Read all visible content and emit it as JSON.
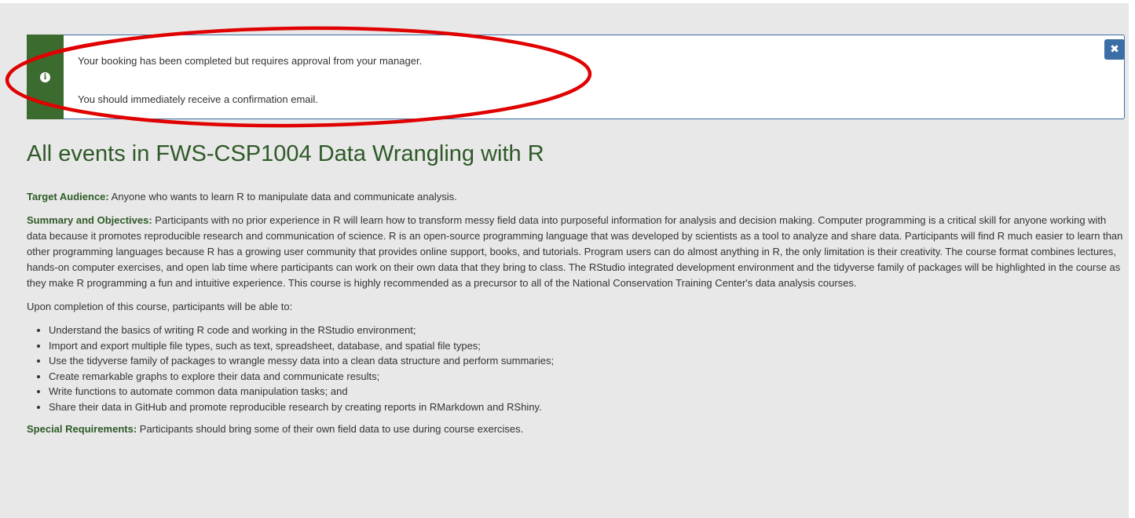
{
  "alert": {
    "icon": "info-icon",
    "line1": "Your booking has been completed but requires approval from your manager.",
    "line2": "You should immediately receive a confirmation email.",
    "close_icon": "close-icon",
    "close_symbol": "✖"
  },
  "page": {
    "title": "All events in FWS-CSP1004 Data Wrangling with R"
  },
  "course": {
    "target_audience_label": "Target Audience:",
    "target_audience_text": "Anyone who wants to learn R to manipulate data and communicate analysis.",
    "summary_label": "Summary and Objectives:",
    "summary_text": "Participants with no prior experience in R will learn how to transform messy field data into purposeful information for analysis and decision making. Computer programming is a critical skill for anyone working with data because it promotes reproducible research and communication of science. R is an open-source programming language that was developed by scientists as a tool to analyze and share data. Participants will find R much easier to learn than other programming languages because R has a growing user community that provides online support, books, and tutorials. Program users can do almost anything in R, the only limitation is their creativity. The course format combines lectures, hands-on computer exercises, and open lab time where participants can work on their own data that they bring to class. The RStudio integrated development environment and the tidyverse family of packages will be highlighted in the course as they make R programming a fun and intuitive experience. This course is highly recommended as a precursor to all of the National Conservation Training Center's data analysis courses.",
    "completion_intro": "Upon completion of this course, participants will be able to:",
    "objectives": [
      "Understand the basics of writing R code and working in the RStudio environment;",
      "Import and export multiple file types, such as text, spreadsheet, database, and spatial file types;",
      "Use the tidyverse family of packages to wrangle messy data into a clean data structure and perform summaries;",
      "Create remarkable graphs to explore their data and communicate results;",
      "Write functions to automate common data manipulation tasks; and",
      "Share their data in GitHub and promote reproducible research by creating reports in RMarkdown and RShiny."
    ],
    "special_label": "Special Requirements:",
    "special_text": "Participants should bring some of their own field data to use during course exercises."
  },
  "colors": {
    "heading_green": "#2e5a27",
    "alert_bar_green": "#3c6b2f",
    "alert_border_blue": "#3a6ea5",
    "annotation_red": "#e00000",
    "page_background": "#e8e8e8"
  }
}
